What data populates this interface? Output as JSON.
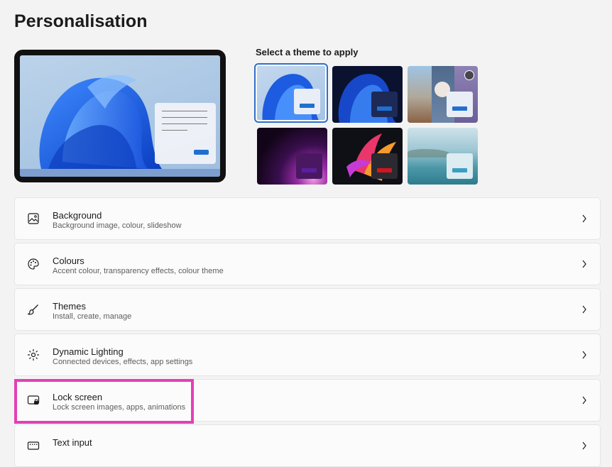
{
  "page": {
    "title": "Personalisation"
  },
  "theme_picker": {
    "heading": "Select a theme to apply",
    "themes": [
      {
        "name": "windows-light",
        "selected": true,
        "accent": "#1f6fd1"
      },
      {
        "name": "windows-dark",
        "selected": false,
        "accent": "#1f6fd1"
      },
      {
        "name": "glow",
        "selected": false,
        "accent": "#1f6fd1"
      },
      {
        "name": "captured-motion",
        "selected": false,
        "accent": "#5a1fa0"
      },
      {
        "name": "sunrise",
        "selected": false,
        "accent": "#d4151e"
      },
      {
        "name": "flow",
        "selected": false,
        "accent": "#3b9fc3"
      }
    ]
  },
  "settings": [
    {
      "id": "background",
      "icon": "image-icon",
      "title": "Background",
      "subtitle": "Background image, colour, slideshow"
    },
    {
      "id": "colours",
      "icon": "palette-icon",
      "title": "Colours",
      "subtitle": "Accent colour, transparency effects, colour theme"
    },
    {
      "id": "themes",
      "icon": "brush-icon",
      "title": "Themes",
      "subtitle": "Install, create, manage"
    },
    {
      "id": "dynamic-lighting",
      "icon": "lighting-icon",
      "title": "Dynamic Lighting",
      "subtitle": "Connected devices, effects, app settings"
    },
    {
      "id": "lock-screen",
      "icon": "lock-screen-icon",
      "title": "Lock screen",
      "subtitle": "Lock screen images, apps, animations"
    },
    {
      "id": "text-input",
      "icon": "keyboard-icon",
      "title": "Text input",
      "subtitle": ""
    }
  ],
  "colors": {
    "highlight": "#e43fb7",
    "accent": "#2f6fc9"
  }
}
